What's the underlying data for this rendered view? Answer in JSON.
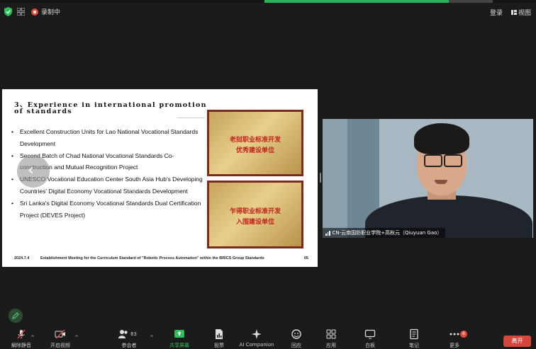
{
  "topbar": {
    "recording_label": "录制中",
    "login_label": "登录",
    "view_label": "视图"
  },
  "slide": {
    "title": "3、Experience in international promotion of standards",
    "bullets": [
      "Excellent Construction Units for Lao National Vocational Standards Development",
      "Second Batch of Chad National Vocational Standards Co-construction and Mutual Recognition Project",
      "UNESCO Vocational Education Center South Asia Hub's Developing Countries' Digital Economy Vocational Standards Development",
      "Sri Lanka's Digital Economy Vocational Standards Dual Certification Project (DEVES Project)"
    ],
    "plaque_top": {
      "main_line1": "老挝职业标准开发",
      "main_line2": "优秀建设单位"
    },
    "plaque_bottom": {
      "main_line1": "乍得职业标准开发",
      "main_line2": "入围建设单位"
    },
    "footer_date": "2024.7.4",
    "footer_text": "Establishment Meeting for the Curriculum Standard of \"Robotic Process Automation\" within the BRICS Group Standards",
    "footer_page": "05"
  },
  "video": {
    "participant_label": "CN-云南国防职业学院+高秋元（Qiuyuan Gao）"
  },
  "toolbar": {
    "items": [
      {
        "label": "解除静音"
      },
      {
        "label": "开启视频"
      },
      {
        "label": "参会者",
        "count": "83"
      },
      {
        "label": "共享屏幕"
      },
      {
        "label": "投票"
      },
      {
        "label": "AI Companion"
      },
      {
        "label": "回应"
      },
      {
        "label": "应用"
      },
      {
        "label": "白板"
      },
      {
        "label": "笔记"
      },
      {
        "label": "更多",
        "badge": "6"
      }
    ],
    "leave_label": "离开"
  },
  "colors": {
    "accent_green": "#2fbf5a",
    "leave_red": "#d8453a",
    "badge_red": "#e04a3f"
  }
}
